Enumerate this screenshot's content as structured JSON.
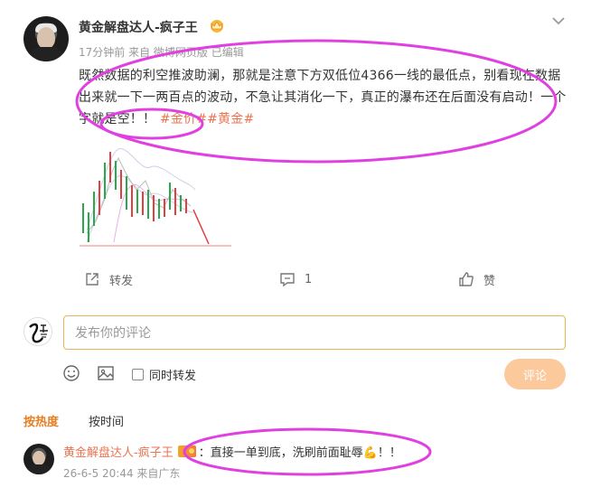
{
  "post": {
    "author": "黄金解盘达人-疯子王",
    "meta": "17分钟前 来自 微博网页版 已编辑",
    "text": "既然数据的利空推波助澜，那就是注意下方双低位4366一线的最低点，别看现在数据出来就一下一两百点的波动，不急让其消化一下，真正的瀑布还在后面没有启动！一个字就是空！！",
    "tags": "#金价##黄金#",
    "icons": {
      "crown": "crown-badge-icon",
      "more": "chevron-down-icon"
    }
  },
  "actions": {
    "repost_label": "转发",
    "comment_count": "1",
    "like_label": "赞"
  },
  "comment_box": {
    "placeholder": "发布你的评论",
    "repost_option": "同时转发",
    "submit_label": "评论",
    "icons": [
      "emoji-icon",
      "image-icon"
    ]
  },
  "sort": {
    "hot": "按热度",
    "time": "按时间"
  },
  "comments": [
    {
      "user": "黄金解盘达人-疯子王",
      "text": "：直接一单到底，洗刷前面耻辱💪！！",
      "meta": "26-6-5 20:44 来自广东"
    }
  ],
  "colors": {
    "accent": "#eb7350",
    "annotation": "#e040e0",
    "input_border": "#e4b55b",
    "submit_bg": "#fbc99c"
  }
}
